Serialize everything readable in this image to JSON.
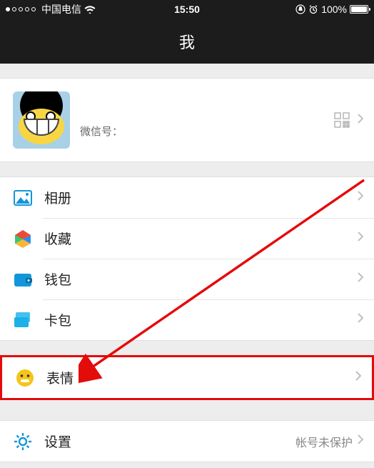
{
  "status_bar": {
    "carrier": "中国电信",
    "time": "15:50",
    "battery_pct": "100%"
  },
  "nav": {
    "title": "我"
  },
  "profile": {
    "name": "",
    "wxid_label": "微信号：",
    "wxid_value": ""
  },
  "rows": {
    "album": "相册",
    "favorites": "收藏",
    "wallet": "钱包",
    "cards": "卡包",
    "stickers": "表情",
    "settings": "设置",
    "settings_detail": "帐号未保护"
  }
}
